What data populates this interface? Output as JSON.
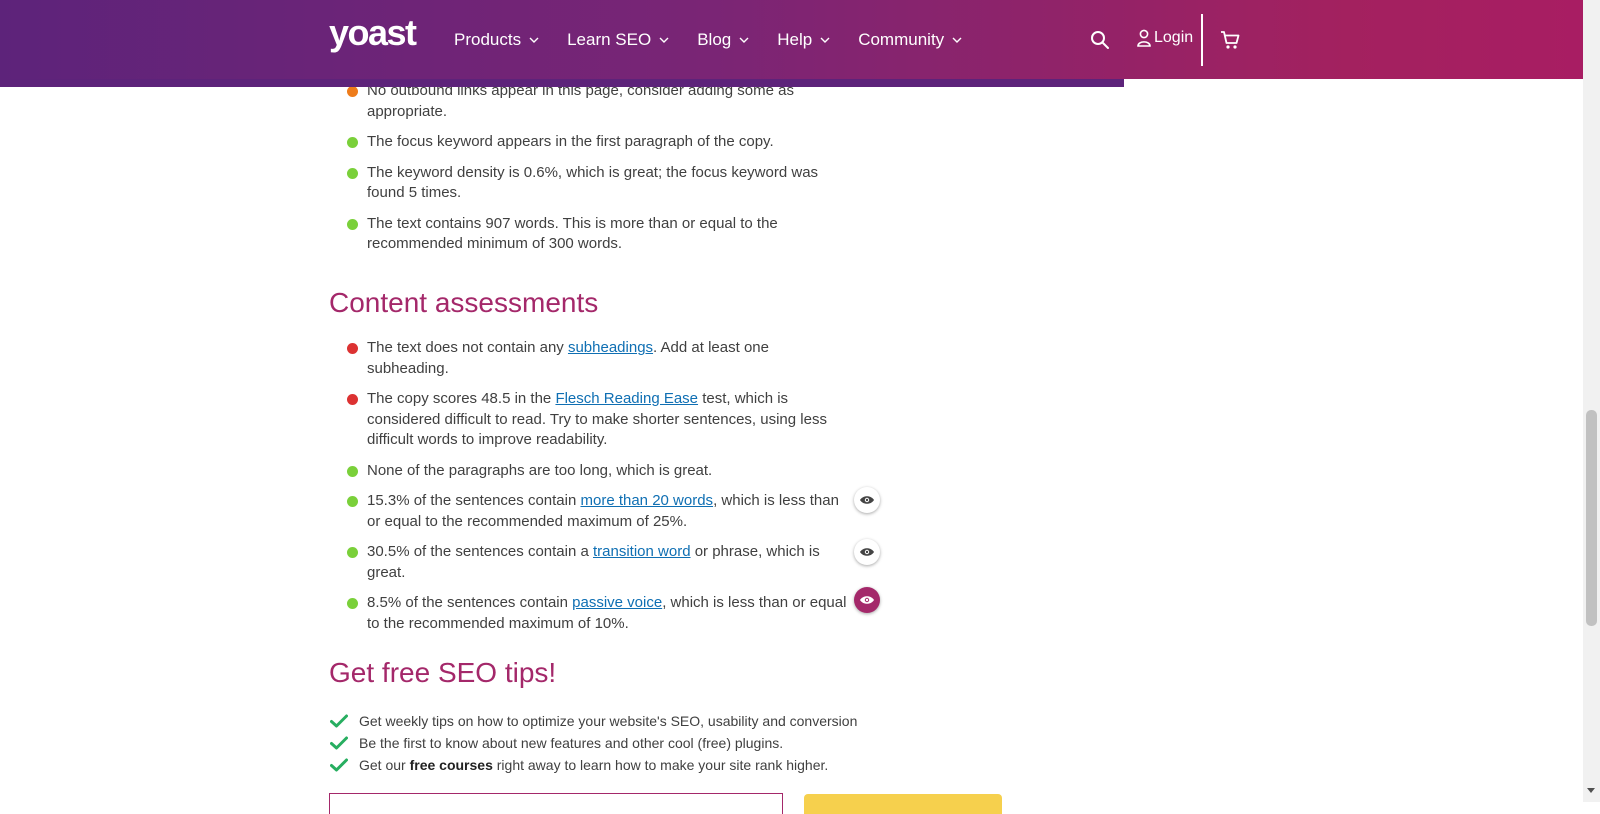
{
  "header": {
    "logo": "yoast",
    "nav": [
      {
        "label": "Products"
      },
      {
        "label": "Learn SEO"
      },
      {
        "label": "Blog"
      },
      {
        "label": "Help"
      },
      {
        "label": "Community"
      }
    ],
    "login_label": "Login",
    "brand_colors": {
      "gradient_start": "#5d237a",
      "gradient_end": "#a81d63"
    }
  },
  "colors": {
    "good": "#7ad03a",
    "ok": "#ee7c1b",
    "bad": "#dc3232",
    "heading": "#a4286a",
    "link": "#0f6fb3",
    "check": "#27ae60",
    "subscribe_button": "#f6d04d"
  },
  "seo_assessments": {
    "items": [
      {
        "status": "ok",
        "text": "No outbound links appear in this page, consider adding some as appropriate."
      },
      {
        "status": "good",
        "text": "The focus keyword appears in the first paragraph of the copy."
      },
      {
        "status": "good",
        "text": "The keyword density is 0.6%, which is great; the focus keyword was found 5 times."
      },
      {
        "status": "good",
        "text": "The text contains 907 words. This is more than or equal to the recommended minimum of 300 words."
      }
    ]
  },
  "content_assessments": {
    "heading": "Content assessments",
    "items": [
      {
        "status": "bad",
        "before": "The text does not contain any ",
        "link": "subheadings",
        "after": ". Add at least one subheading."
      },
      {
        "status": "bad",
        "before": "The copy scores 48.5 in the ",
        "link": "Flesch Reading Ease",
        "after": " test, which is considered difficult to read. Try to make shorter sentences, using less difficult words to improve readability."
      },
      {
        "status": "good",
        "before": "None of the paragraphs are too long, which is great.",
        "link": "",
        "after": ""
      },
      {
        "status": "good",
        "before": "15.3% of the sentences contain ",
        "link": "more than 20 words",
        "after": ", which is less than or equal to the recommended maximum of 25%.",
        "eye": "inactive"
      },
      {
        "status": "good",
        "before": "30.5% of the sentences contain a ",
        "link": "transition word",
        "after": " or phrase, which is great.",
        "eye": "inactive"
      },
      {
        "status": "good",
        "before": "8.5% of the sentences contain ",
        "link": "passive voice",
        "after": ", which is less than or equal to the recommended maximum of 10%.",
        "eye": "active"
      }
    ]
  },
  "newsletter": {
    "heading": "Get free SEO tips!",
    "tips": [
      {
        "before": "Get weekly tips on how to optimize your website's SEO, usability and conversion",
        "bold": "",
        "after": ""
      },
      {
        "before": "Be the first to know about new features and other cool (free) plugins.",
        "bold": "",
        "after": ""
      },
      {
        "before": "Get our ",
        "bold": "free courses",
        "after": " right away to learn how to make your site rank higher."
      }
    ]
  }
}
